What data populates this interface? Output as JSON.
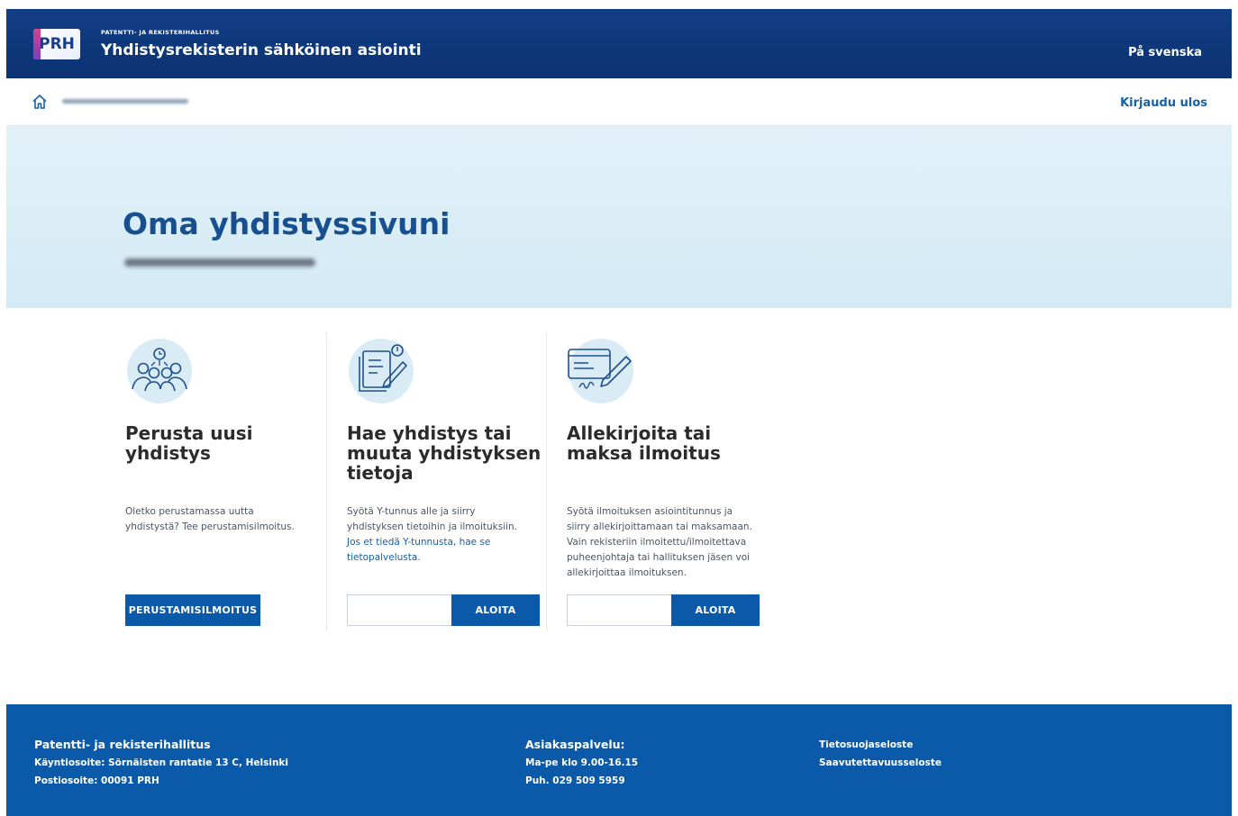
{
  "header": {
    "org_small": "PATENTTI- JA REKISTERIHALLITUS",
    "logo_text": "PRH",
    "service_title": "Yhdistysrekisterin sähköinen asiointi",
    "language_link": "På svenska"
  },
  "nav": {
    "home_icon": "home-icon",
    "logout_link": "Kirjaudu ulos"
  },
  "hero": {
    "title": "Oma yhdistyssivuni"
  },
  "cards": [
    {
      "icon": "people-group-icon",
      "title_line1": "Perusta uusi",
      "title_line2": "yhdistys",
      "text_line1": "Oletko perustamassa uutta",
      "text_line2": "yhdistystä? Tee perustamisilmoitus.",
      "button_label": "PERUSTAMISILMOITUS"
    },
    {
      "icon": "document-edit-icon",
      "title_line1": "Hae yhdistys tai",
      "title_line2": "muuta yhdistyksen",
      "title_line3": "tietoja",
      "text_line1": "Syötä Y-tunnus alle ja siirry",
      "text_line2": "yhdistyksen tietoihin ja ilmoituksiin.",
      "link_line1": "Jos et tiedä Y-tunnusta, hae se",
      "link_line2": "tietopalvelusta.",
      "input_value": "",
      "button_label": "ALOITA"
    },
    {
      "icon": "card-sign-icon",
      "title_line1": "Allekirjoita tai",
      "title_line2": "maksa ilmoitus",
      "text_line1": "Syötä ilmoituksen asiointitunnus ja",
      "text_line2": "siirry allekirjoittamaan tai maksamaan.",
      "text_line3": "Vain rekisteriin ilmoitettu/ilmoitettava",
      "text_line4": "puheenjohtaja tai hallituksen jäsen voi",
      "text_line5": "allekirjoittaa ilmoituksen.",
      "input_value": "",
      "button_label": "ALOITA"
    }
  ],
  "footer": {
    "org_name": "Patentti- ja rekisterihallitus",
    "visit_address": "Käyntiosoite: Sörnäisten rantatie 13 C, Helsinki",
    "postal_address": "Postiosoite: 00091 PRH",
    "service_title": "Asiakaspalvelu:",
    "service_hours": "Ma-pe klo 9.00-16.15",
    "service_phone": "Puh. 029 509 5959",
    "privacy_link": "Tietosuojaseloste",
    "accessibility_link": "Saavutettavuusseloste"
  },
  "colors": {
    "header_bg": "#0b3272",
    "primary": "#0b5aa9",
    "hero_bg": "#dcedf6",
    "title_blue": "#18508f",
    "link": "#1560a8"
  }
}
